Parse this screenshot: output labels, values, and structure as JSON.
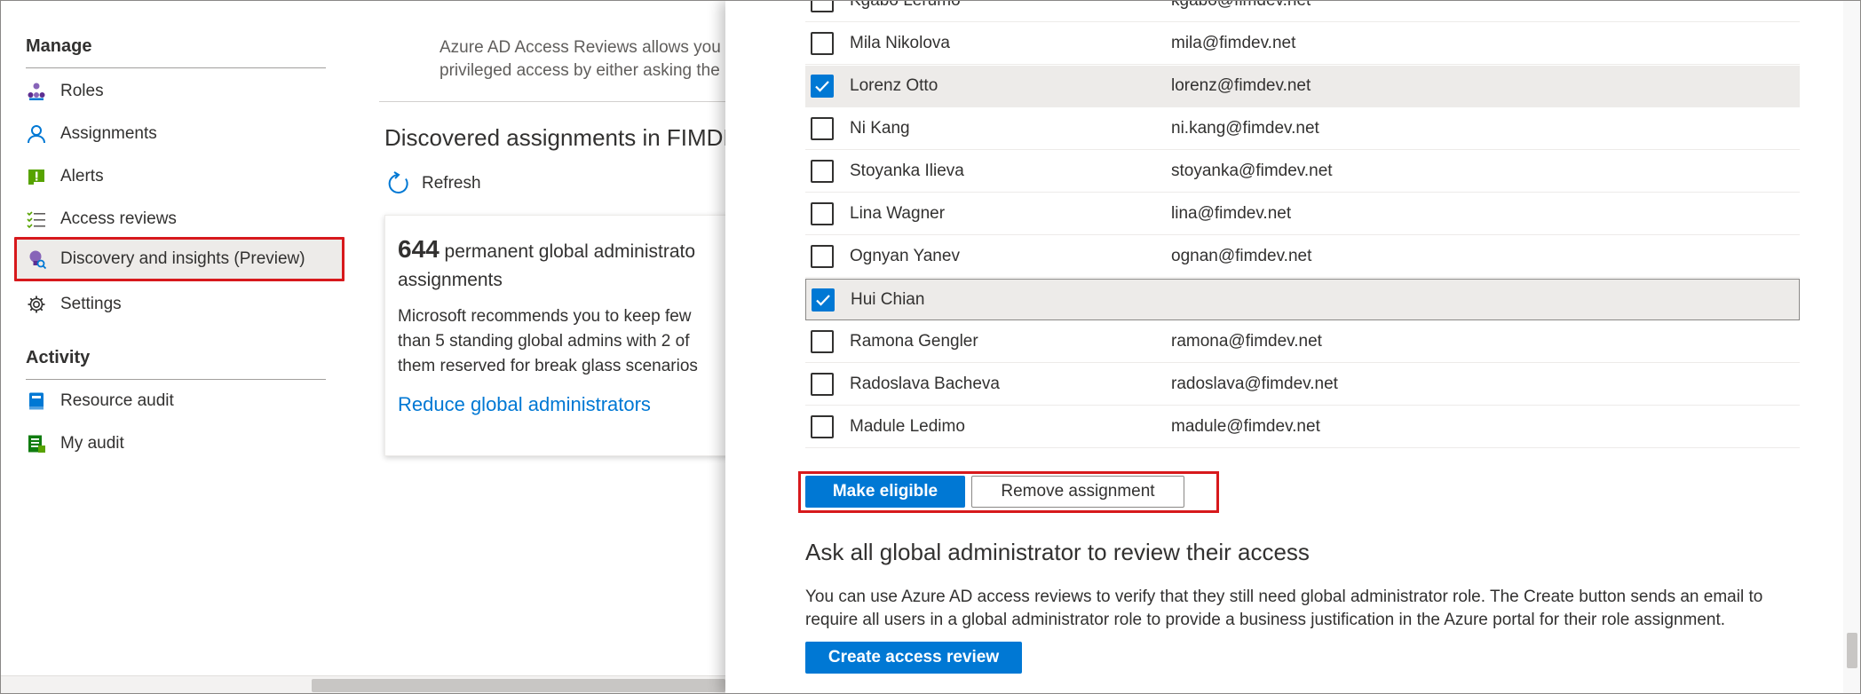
{
  "nav": {
    "manage_heading": "Manage",
    "activity_heading": "Activity",
    "items": [
      {
        "label": "Roles",
        "icon": "roles-icon"
      },
      {
        "label": "Assignments",
        "icon": "person-icon"
      },
      {
        "label": "Alerts",
        "icon": "alert-icon"
      },
      {
        "label": "Access reviews",
        "icon": "checklist-icon"
      },
      {
        "label": "Discovery and insights (Preview)",
        "icon": "lightbulb-icon"
      },
      {
        "label": "Settings",
        "icon": "gear-icon"
      }
    ],
    "activity_items": [
      {
        "label": "Resource audit",
        "icon": "audit-book-icon"
      },
      {
        "label": "My audit",
        "icon": "audit-list-icon"
      }
    ]
  },
  "content": {
    "intro_line1": "Azure AD Access Reviews allows you t",
    "intro_line2": "privileged access by either asking the",
    "section_title": "Discovered assignments in FIMDE",
    "refresh_label": "Refresh",
    "card": {
      "count": "644",
      "title_rest": " permanent global administrato",
      "title_line2": "assignments",
      "desc_line1": "Microsoft recommends you to keep few",
      "desc_line2": "than 5 standing global admins with 2 of",
      "desc_line3": "them reserved for break glass scenarios",
      "link": "Reduce global administrators"
    }
  },
  "panel": {
    "rows": [
      {
        "name": "Kgabo Lerumo",
        "email": "kgabo@fimdev.net",
        "checked": false
      },
      {
        "name": "Mila Nikolova",
        "email": "mila@fimdev.net",
        "checked": false
      },
      {
        "name": "Lorenz Otto",
        "email": "lorenz@fimdev.net",
        "checked": true
      },
      {
        "name": "Ni Kang",
        "email": "ni.kang@fimdev.net",
        "checked": false
      },
      {
        "name": "Stoyanka Ilieva",
        "email": "stoyanka@fimdev.net",
        "checked": false
      },
      {
        "name": "Lina Wagner",
        "email": "lina@fimdev.net",
        "checked": false
      },
      {
        "name": "Ognyan Yanev",
        "email": "ognan@fimdev.net",
        "checked": false
      },
      {
        "name": "Hui Chian",
        "email": "",
        "checked": true
      },
      {
        "name": "Ramona Gengler",
        "email": "ramona@fimdev.net",
        "checked": false
      },
      {
        "name": "Radoslava Bacheva",
        "email": "radoslava@fimdev.net",
        "checked": false
      },
      {
        "name": "Madule Ledimo",
        "email": "madule@fimdev.net",
        "checked": false
      }
    ],
    "make_eligible_label": "Make eligible",
    "remove_assignment_label": "Remove assignment",
    "ask_title": "Ask all global administrator to review their access",
    "ask_desc_line1": "You can use Azure AD access reviews to verify that they still need global administrator role. The Create button sends an email to",
    "ask_desc_line2": "require all users in a global administrator role to provide a business justification in the Azure portal for their role assignment.",
    "create_label": "Create access review"
  },
  "colors": {
    "accent": "#0078d4",
    "highlight_border": "#d7191c",
    "selected_row": "#edebe9"
  }
}
